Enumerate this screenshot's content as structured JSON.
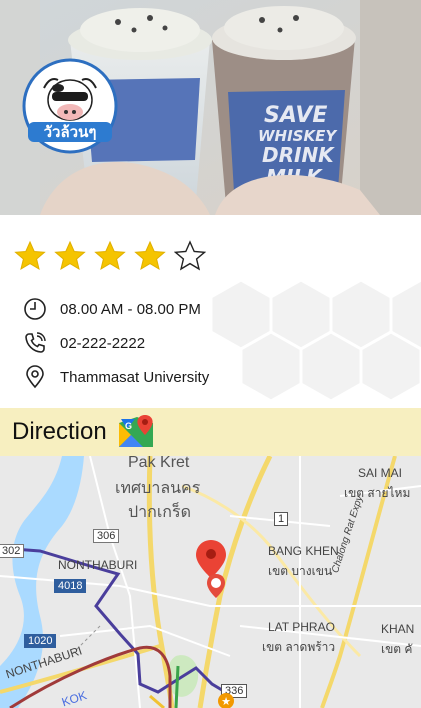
{
  "hero": {
    "logo_text": "วัวล้วนๆ",
    "cup_text": [
      "SAVE",
      "WHISKEY",
      "DRINK",
      "MILK"
    ]
  },
  "rating": {
    "value": 4,
    "max": 5
  },
  "info": {
    "hours": "08.00 AM - 08.00 PM",
    "phone": "02-222-2222",
    "location": "Thammasat University"
  },
  "direction": {
    "label": "Direction",
    "icon": "google-maps-icon"
  },
  "map": {
    "labels": {
      "pak_kret_en": "Pak Kret",
      "pak_kret_th1": "เทศบาลนคร",
      "pak_kret_th2": "ปากเกร็ด",
      "sai_mai_en": "SAI MAI",
      "sai_mai_th": "เขต สายไหม",
      "nonthaburi_en": "NONTHABURI",
      "bang_khen_en": "BANG KHEN",
      "bang_khen_th": "เขต บางเขน",
      "lat_phrao_en": "LAT PHRAO",
      "lat_phrao_th": "เขต ลาดพร้าว",
      "khan_en": "KHAN",
      "khan_th": "เขต คั",
      "chalong": "Chalong Rat Expy",
      "nonthaburi2": "NONTHABURI",
      "kok": "KOK"
    },
    "shields": {
      "r306": "306",
      "r302": "302",
      "r4018": "4018",
      "r1": "1",
      "r1020": "1020",
      "r336": "336"
    }
  }
}
